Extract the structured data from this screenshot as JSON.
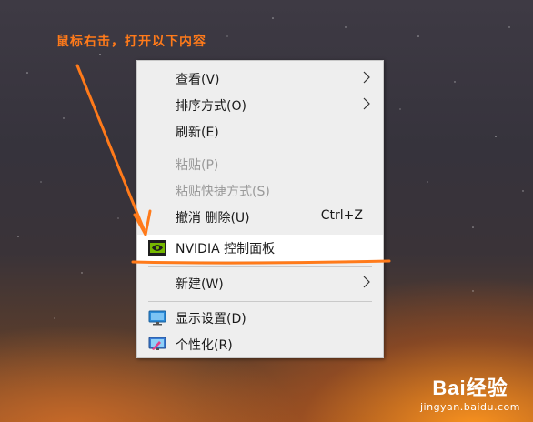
{
  "annotation": {
    "text": "鼠标右击，打开以下内容"
  },
  "menu": {
    "items": [
      {
        "label": "查看(V)",
        "submenu": true
      },
      {
        "label": "排序方式(O)",
        "submenu": true
      },
      {
        "label": "刷新(E)"
      },
      {
        "label": "粘贴(P)",
        "disabled": true
      },
      {
        "label": "粘贴快捷方式(S)",
        "disabled": true
      },
      {
        "label": "撤消 删除(U)",
        "shortcut": "Ctrl+Z"
      },
      {
        "label": "NVIDIA 控制面板",
        "icon": "nvidia-icon",
        "highlighted": true
      },
      {
        "label": "新建(W)",
        "submenu": true
      },
      {
        "label": "显示设置(D)",
        "icon": "display-settings-icon"
      },
      {
        "label": "个性化(R)",
        "icon": "personalize-icon"
      }
    ]
  },
  "watermark": {
    "brand": "Bai经验",
    "url": "jingyan.baidu.com"
  },
  "colors": {
    "annotation": "#ff7a1a",
    "menu_bg": "#eeeeee",
    "highlight": "#ffffff",
    "nvidia_green": "#76b900"
  }
}
